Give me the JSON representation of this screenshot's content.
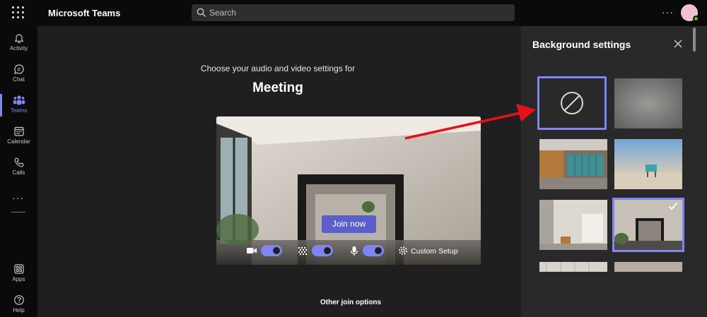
{
  "app": {
    "title": "Microsoft Teams"
  },
  "search": {
    "placeholder": "Search"
  },
  "rail": {
    "items": [
      {
        "label": "Activity",
        "icon": "bell-icon"
      },
      {
        "label": "Chat",
        "icon": "chat-icon"
      },
      {
        "label": "Teams",
        "icon": "teams-icon",
        "active": true
      },
      {
        "label": "Calendar",
        "icon": "calendar-icon"
      },
      {
        "label": "Calls",
        "icon": "phone-icon"
      }
    ],
    "more_label": "...",
    "bottom": [
      {
        "label": "Apps",
        "icon": "apps-icon"
      },
      {
        "label": "Help",
        "icon": "help-icon"
      }
    ]
  },
  "prejoin": {
    "subtitle": "Choose your audio and video settings for",
    "meeting_title": "Meeting",
    "join_label": "Join now",
    "camera_on": true,
    "blur_on": true,
    "mic_on": true,
    "custom_setup_label": "Custom Setup",
    "other_options_label": "Other join options"
  },
  "background_panel": {
    "title": "Background settings",
    "selected_index": 5,
    "thumbnails": [
      {
        "name": "no-background",
        "icon": "none-icon"
      },
      {
        "name": "blur"
      },
      {
        "name": "office-lockers"
      },
      {
        "name": "beach-lifeguard"
      },
      {
        "name": "white-loft"
      },
      {
        "name": "mirror-room"
      }
    ]
  },
  "colors": {
    "accent": "#7f85f5",
    "join_button": "#5b5fc7",
    "annotation_arrow": "#e8101a",
    "presence": "#6bb700"
  }
}
